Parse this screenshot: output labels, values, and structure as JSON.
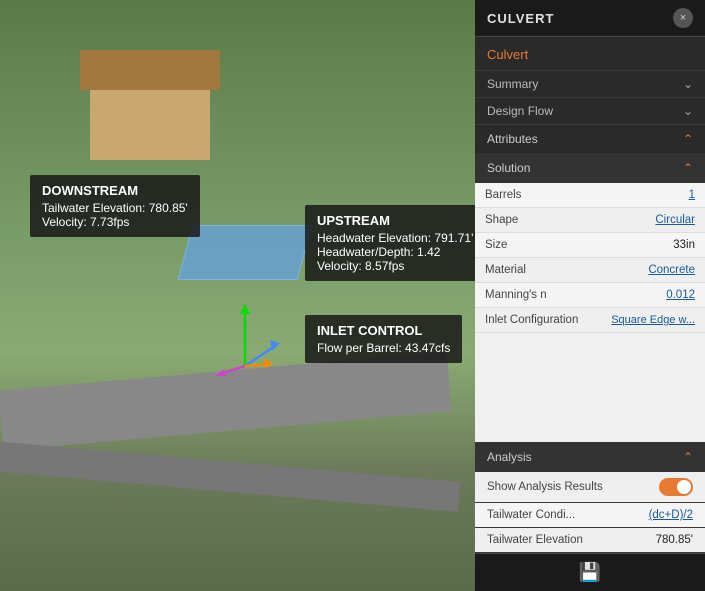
{
  "panel": {
    "title": "CULVERT",
    "close_button": "×",
    "culvert_label": "Culvert",
    "summary_label": "Summary",
    "design_flow_label": "Design Flow",
    "attributes_label": "Attributes",
    "solution_label": "Solution",
    "attributes": {
      "barrels_key": "Barrels",
      "barrels_val": "1",
      "shape_key": "Shape",
      "shape_val": "Circular",
      "size_key": "Size",
      "size_val": "33in",
      "material_key": "Material",
      "material_val": "Concrete",
      "mannings_key": "Manning's n",
      "mannings_val": "0.012",
      "inlet_key": "Inlet Configuration",
      "inlet_val": "Square Edge w..."
    },
    "analysis": {
      "label": "Analysis",
      "show_results_key": "Show Analysis Results",
      "tailwater_cond_key": "Tailwater Condi...",
      "tailwater_cond_val": "(dc+D)/2",
      "tailwater_elev_key": "Tailwater Elevation",
      "tailwater_elev_val": "780.85'"
    }
  },
  "scene": {
    "downstream": {
      "title": "DOWNSTREAM",
      "line1": "Tailwater Elevation: 780.85'",
      "line2": "Velocity: 7.73fps"
    },
    "upstream": {
      "title": "UPSTREAM",
      "line1": "Headwater Elevation: 791.71'",
      "line2": "Headwater/Depth: 1.42",
      "line3": "Velocity: 8.57fps"
    },
    "inlet_control": {
      "title": "INLET CONTROL",
      "line1": "Flow per Barrel: 43.47cfs"
    }
  },
  "footer": {
    "save_icon": "💾"
  }
}
